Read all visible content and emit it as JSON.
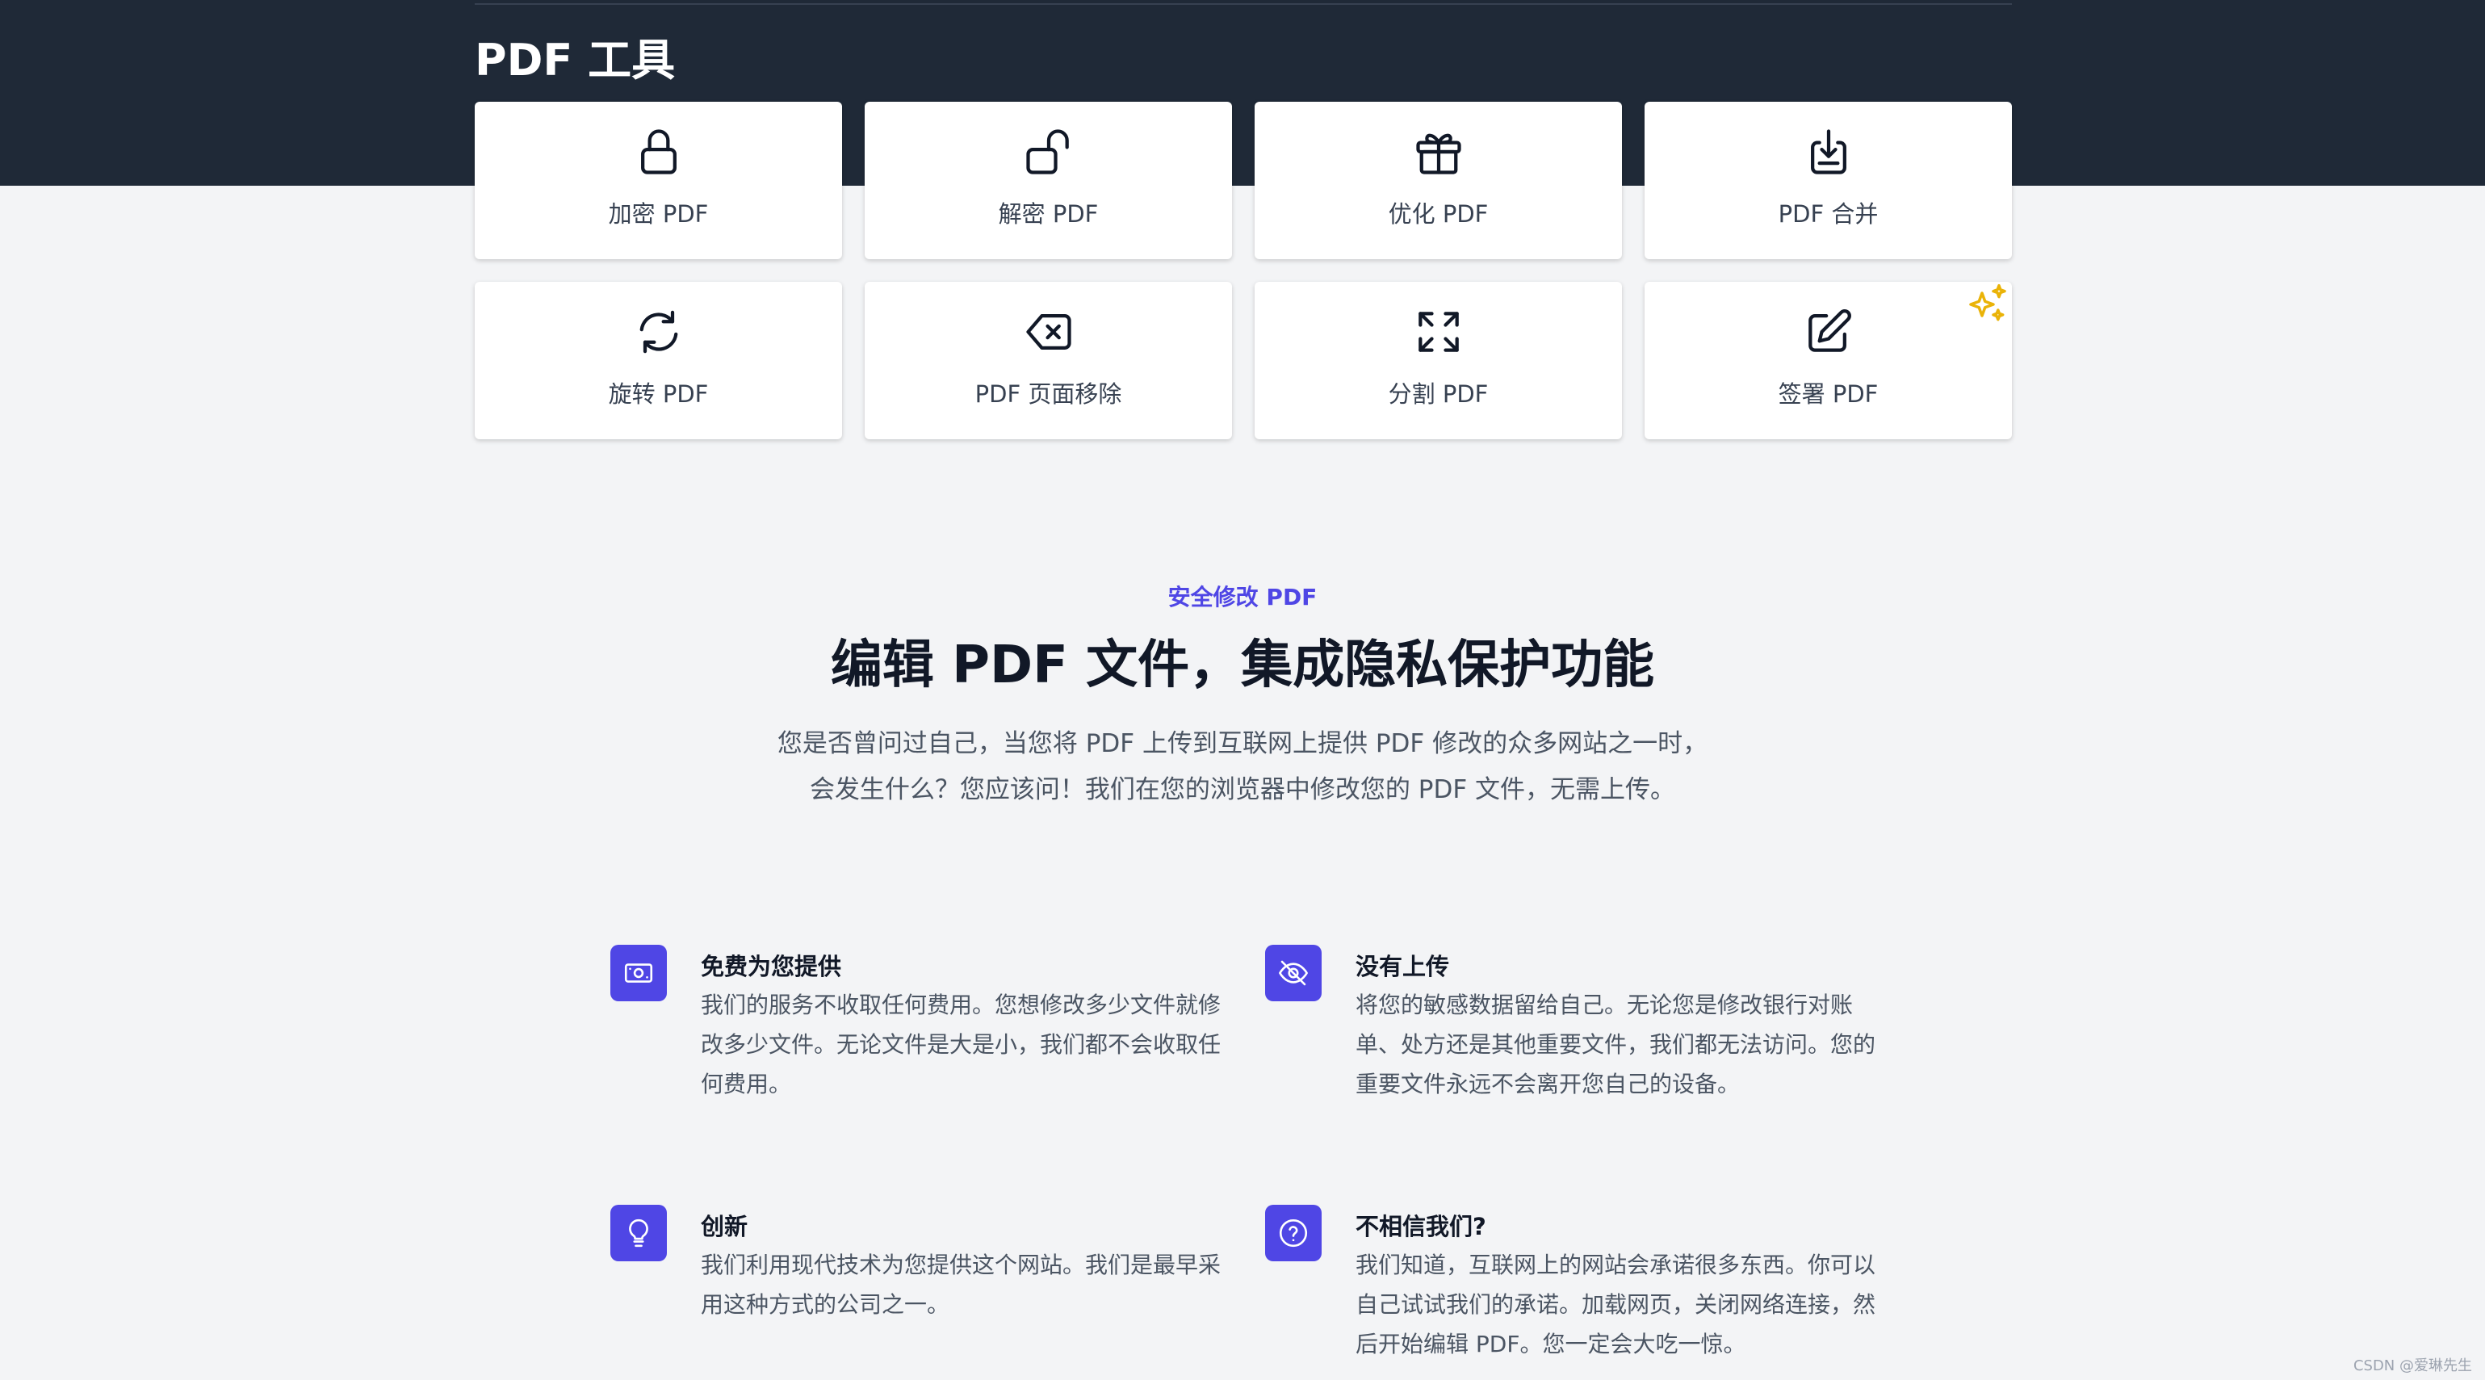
{
  "header": {
    "title": "PDF 工具"
  },
  "tools": [
    {
      "label": "加密 PDF",
      "icon": "lock-icon"
    },
    {
      "label": "解密 PDF",
      "icon": "unlock-icon"
    },
    {
      "label": "优化 PDF",
      "icon": "gift-icon"
    },
    {
      "label": "PDF 合并",
      "icon": "merge-download-icon"
    },
    {
      "label": "旋转 PDF",
      "icon": "rotate-icon"
    },
    {
      "label": "PDF 页面移除",
      "icon": "backspace-delete-icon"
    },
    {
      "label": "分割 PDF",
      "icon": "expand-arrows-icon"
    },
    {
      "label": "签署 PDF",
      "icon": "pencil-square-icon",
      "badge": "sparkles-icon"
    }
  ],
  "intro": {
    "eyebrow": "安全修改 PDF",
    "headline": "编辑 PDF 文件，集成隐私保护功能",
    "line1": "您是否曾问过自己，当您将 PDF 上传到互联网上提供 PDF 修改的众多网站之一时，",
    "line2": "会发生什么？您应该问！我们在您的浏览器中修改您的 PDF 文件，无需上传。"
  },
  "features": [
    {
      "title": "免费为您提供",
      "icon": "banknote-icon",
      "text": "我们的服务不收取任何费用。您想修改多少文件就修改多少文件。无论文件是大是小，我们都不会收取任何费用。"
    },
    {
      "title": "没有上传",
      "icon": "eye-slash-icon",
      "text": "将您的敏感数据留给自己。无论您是修改银行对账单、处方还是其他重要文件，我们都无法访问。您的重要文件永远不会离开您自己的设备。"
    },
    {
      "title": "创新",
      "icon": "lightbulb-icon",
      "text": "我们利用现代技术为您提供这个网站。我们是最早采用这种方式的公司之一。"
    },
    {
      "title": "不相信我们?",
      "icon": "question-circle-icon",
      "text": "我们知道，互联网上的网站会承诺很多东西。你可以自己试试我们的承诺。加载网页，关闭网络连接，然后开始编辑 PDF。您一定会大吃一惊。"
    }
  ],
  "colors": {
    "header_bg": "#1f2937",
    "page_bg": "#f3f4f6",
    "accent": "#4f46e5",
    "badge": "#eab308"
  },
  "watermark": "CSDN @爱琳先生"
}
